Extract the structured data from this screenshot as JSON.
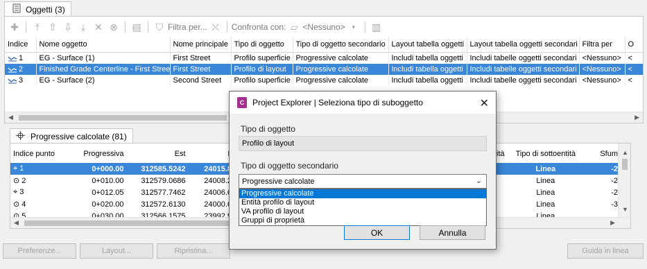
{
  "panel": {
    "tab_label": "Oggetti (3)"
  },
  "toolbar": {
    "filter_label": "Filtra per...",
    "compare_label": "Confronta con:",
    "compare_value": "<Nessuno>"
  },
  "objects_table": {
    "columns": [
      "Indice",
      "Nome oggetto",
      "Nome principale",
      "Tipo di oggetto",
      "Tipo di oggetto secondario",
      "Layout tabella oggetti",
      "Layout tabella oggetti secondari",
      "Filtra per",
      "O"
    ],
    "rows": [
      {
        "index": "1",
        "name": "EG - Surface (1)",
        "parent": "First Street",
        "type": "Profilo superficie",
        "subtype": "Progressive calcolate",
        "layout": "Includi tabella oggetti",
        "sublayout": "Includi tabelle oggetti secondari",
        "filter": "<Nessuno>",
        "selected": false
      },
      {
        "index": "2",
        "name": "Finished Grade Centerline - First Street",
        "parent": "First Street",
        "type": "Profilo di layout",
        "subtype": "Progressive calcolate",
        "layout": "Includi tabella oggetti",
        "sublayout": "Includi tabelle oggetti secondari",
        "filter": "<Nessuno>",
        "selected": true
      },
      {
        "index": "3",
        "name": "EG - Surface (2)",
        "parent": "Second Street",
        "type": "Profilo superficie",
        "subtype": "Progressive calcolate",
        "layout": "Includi tabella oggetti",
        "sublayout": "Includi tabelle oggetti secondari",
        "filter": "<Nessuno>",
        "selected": false
      }
    ]
  },
  "lower_panel": {
    "tab_label": "Progressive calcolate (81)",
    "columns": [
      "Indice punto",
      "Progressiva",
      "Est",
      "Nord",
      "ntità",
      "Tipo di sottoentità",
      "Sfum"
    ],
    "rows": [
      {
        "index": "1",
        "station": "0+000.00",
        "east": "312585.5242",
        "north": "24015.8830",
        "subtype": "Linea",
        "sfum": "-2",
        "selected": true
      },
      {
        "index": "2",
        "station": "0+010.00",
        "east": "312579.0686",
        "north": "24008.2464",
        "subtype": "Linea",
        "sfum": "-2",
        "selected": false
      },
      {
        "index": "3",
        "station": "0+012.05",
        "east": "312577.7462",
        "north": "24006.6820",
        "subtype": "Linea",
        "sfum": "-2",
        "selected": false
      },
      {
        "index": "4",
        "station": "0+020.00",
        "east": "312572.6130",
        "north": "24000.6093",
        "subtype": "Linea",
        "sfum": "-3",
        "selected": false
      },
      {
        "index": "5",
        "station": "0+030.00",
        "east": "312566.1575",
        "north": "23992.9727",
        "subtype": "Linea",
        "sfum": "",
        "selected": false
      }
    ]
  },
  "bottom_buttons": {
    "preferences": "Preferenze...",
    "layout": "Layout...",
    "restore": "Ripristina...",
    "help": "Guida in linea"
  },
  "dialog": {
    "app_icon_letter": "C",
    "title": "Project Explorer | Seleziona tipo di suboggetto",
    "object_type_label": "Tipo di oggetto",
    "object_type_value": "Profilo di layout",
    "secondary_type_label": "Tipo di oggetto secondario",
    "secondary_type_value": "Progressive calcolate",
    "options": [
      "Progressive calcolate",
      "Entità profilo di layout",
      "VA profilo di layout",
      "Gruppi di proprietà"
    ],
    "ok_label": "OK",
    "cancel_label": "Annulla"
  },
  "colors": {
    "selection": "#3a86d8",
    "list_selection": "#0078d7",
    "dialog_bg": "#f0f0f0"
  }
}
